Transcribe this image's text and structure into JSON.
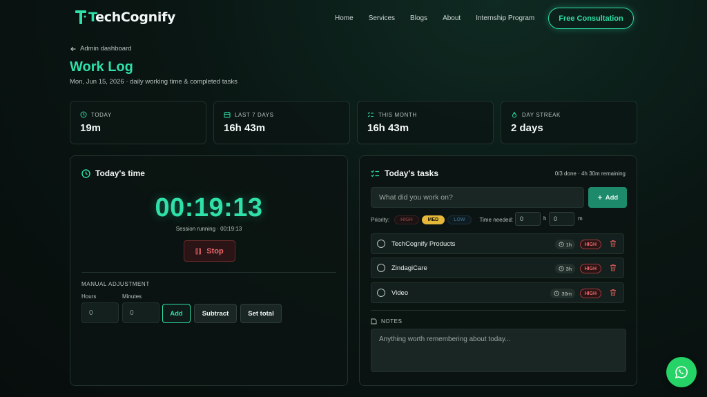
{
  "header": {
    "logo_prefix": "T",
    "logo_text": "echCognify",
    "nav": [
      "Home",
      "Services",
      "Blogs",
      "About",
      "Internship Program"
    ],
    "cta": "Free Consultation"
  },
  "breadcrumb": {
    "back_label": "Admin dashboard"
  },
  "page": {
    "title": "Work Log",
    "subtitle": "Mon, Jun 15, 2026 · daily working time & completed tasks"
  },
  "stats": [
    {
      "label": "TODAY",
      "value": "19m",
      "icon": "clock-icon"
    },
    {
      "label": "LAST 7 DAYS",
      "value": "16h 43m",
      "icon": "calendar-icon"
    },
    {
      "label": "THIS MONTH",
      "value": "16h 43m",
      "icon": "checklist-icon"
    },
    {
      "label": "DAY STREAK",
      "value": "2 days",
      "icon": "flame-icon"
    }
  ],
  "time_panel": {
    "title": "Today's time",
    "timer": "00:19:13",
    "session": "Session running · 00:19:13",
    "stop_label": "Stop",
    "manual_label": "MANUAL ADJUSTMENT",
    "hours_label": "Hours",
    "minutes_label": "Minutes",
    "hours_value": "0",
    "minutes_value": "0",
    "add_label": "Add",
    "subtract_label": "Subtract",
    "set_total_label": "Set total"
  },
  "tasks_panel": {
    "title": "Today's tasks",
    "meta": "0/3 done · 4h 30m remaining",
    "input_placeholder": "What did you work on?",
    "add_label": "Add",
    "priority_label": "Priority:",
    "priorities": [
      "HIGH",
      "MED",
      "LOW"
    ],
    "selected_priority": "MED",
    "time_needed_label": "Time needed:",
    "time_h_value": "0",
    "time_h_unit": "h",
    "time_m_value": "0",
    "time_m_unit": "m",
    "tasks": [
      {
        "name": "TechCognify Products",
        "time": "1h",
        "priority": "HIGH"
      },
      {
        "name": "ZindagiCare",
        "time": "3h",
        "priority": "HIGH"
      },
      {
        "name": "Video",
        "time": "30m",
        "priority": "HIGH"
      }
    ],
    "notes_label": "NOTES",
    "notes_placeholder": "Anything worth remembering about today..."
  },
  "colors": {
    "accent": "#2fe0a8",
    "danger": "#ef6a6a",
    "medium": "#e5b83a",
    "whatsapp": "#25d366"
  }
}
